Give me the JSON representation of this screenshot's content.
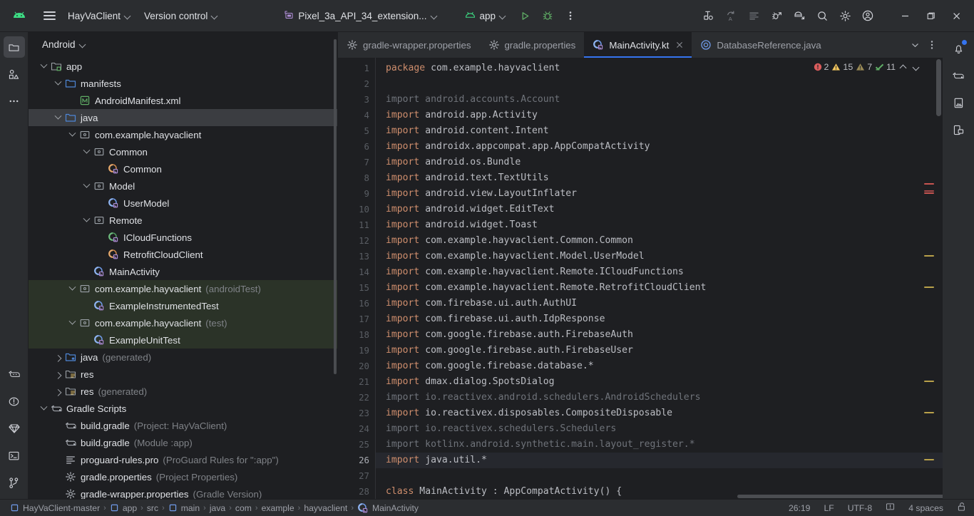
{
  "toolbar": {
    "logo_icon": "android-logo-icon",
    "menu_icon": "hamburger-menu-icon",
    "project_name": "HayVaClient",
    "vcs_label": "Version control",
    "device_label": "Pixel_3a_API_34_extension...",
    "run_config_label": "app",
    "run_icon": "run-play-icon",
    "debug_icon": "debug-bug-icon",
    "more_icon": "more-vertical-icon",
    "right_icons": [
      "make-project-icon",
      "code-with-me-icon",
      "profiler-icon",
      "app-inspection-icon",
      "device-manager-icon",
      "search-everywhere-icon",
      "settings-gear-icon",
      "account-avatar-icon"
    ],
    "window_minimize": "minimize-icon",
    "window_maximize": "maximize-icon",
    "window_close": "close-icon"
  },
  "left_strip": {
    "top_icons": [
      "project-folder-icon",
      "resource-manager-icon",
      "more-tool-windows-icon"
    ],
    "bottom_icons": [
      "gitlab-icon",
      "problems-icon",
      "gemini-icon",
      "terminal-icon",
      "version-control-icon"
    ]
  },
  "right_strip": {
    "icons": [
      "notifications-bell-icon",
      "gradle-elephant-icon",
      "device-file-explorer-icon",
      "emulator-icon"
    ],
    "notification_dot_color": "#3574f0"
  },
  "project_panel": {
    "view_label": "Android",
    "tree": [
      {
        "indent": 0,
        "arrow": "down",
        "icon": "module-folder-icon",
        "label": "app",
        "sub": "",
        "state": ""
      },
      {
        "indent": 1,
        "arrow": "down",
        "icon": "folder-blue-icon",
        "label": "manifests",
        "sub": "",
        "state": ""
      },
      {
        "indent": 2,
        "arrow": "none",
        "icon": "manifest-xml-icon",
        "label": "AndroidManifest.xml",
        "sub": "",
        "state": ""
      },
      {
        "indent": 1,
        "arrow": "down",
        "icon": "folder-blue-icon",
        "label": "java",
        "sub": "",
        "state": "selected"
      },
      {
        "indent": 2,
        "arrow": "down",
        "icon": "package-icon",
        "label": "com.example.hayvaclient",
        "sub": "",
        "state": ""
      },
      {
        "indent": 3,
        "arrow": "down",
        "icon": "package-icon",
        "label": "Common",
        "sub": "",
        "state": ""
      },
      {
        "indent": 4,
        "arrow": "none",
        "icon": "kotlin-class-orange-icon",
        "label": "Common",
        "sub": "",
        "state": ""
      },
      {
        "indent": 3,
        "arrow": "down",
        "icon": "package-icon",
        "label": "Model",
        "sub": "",
        "state": ""
      },
      {
        "indent": 4,
        "arrow": "none",
        "icon": "kotlin-class-blue-icon",
        "label": "UserModel",
        "sub": "",
        "state": ""
      },
      {
        "indent": 3,
        "arrow": "down",
        "icon": "package-icon",
        "label": "Remote",
        "sub": "",
        "state": ""
      },
      {
        "indent": 4,
        "arrow": "none",
        "icon": "kotlin-interface-green-icon",
        "label": "ICloudFunctions",
        "sub": "",
        "state": ""
      },
      {
        "indent": 4,
        "arrow": "none",
        "icon": "kotlin-class-orange-icon",
        "label": "RetrofitCloudClient",
        "sub": "",
        "state": ""
      },
      {
        "indent": 3,
        "arrow": "none",
        "icon": "kotlin-class-blue-icon",
        "label": "MainActivity",
        "sub": "",
        "state": ""
      },
      {
        "indent": 2,
        "arrow": "down",
        "icon": "package-icon",
        "label": "com.example.hayvaclient",
        "sub": "(androidTest)",
        "state": "test"
      },
      {
        "indent": 3,
        "arrow": "none",
        "icon": "kotlin-class-blue-icon",
        "label": "ExampleInstrumentedTest",
        "sub": "",
        "state": "test"
      },
      {
        "indent": 2,
        "arrow": "down",
        "icon": "package-icon",
        "label": "com.example.hayvaclient",
        "sub": "(test)",
        "state": "test"
      },
      {
        "indent": 3,
        "arrow": "none",
        "icon": "kotlin-class-blue-icon",
        "label": "ExampleUnitTest",
        "sub": "",
        "state": "test"
      },
      {
        "indent": 1,
        "arrow": "right",
        "icon": "folder-generated-icon",
        "label": "java",
        "sub": "(generated)",
        "state": ""
      },
      {
        "indent": 1,
        "arrow": "right",
        "icon": "res-folder-icon",
        "label": "res",
        "sub": "",
        "state": ""
      },
      {
        "indent": 1,
        "arrow": "right",
        "icon": "res-folder-icon",
        "label": "res",
        "sub": "(generated)",
        "state": ""
      },
      {
        "indent": 0,
        "arrow": "down",
        "icon": "gradle-elephant-icon",
        "label": "Gradle Scripts",
        "sub": "",
        "state": ""
      },
      {
        "indent": 1,
        "arrow": "none",
        "icon": "gradle-elephant-icon",
        "label": "build.gradle",
        "sub": "(Project: HayVaClient)",
        "state": ""
      },
      {
        "indent": 1,
        "arrow": "none",
        "icon": "gradle-elephant-icon",
        "label": "build.gradle",
        "sub": "(Module :app)",
        "state": ""
      },
      {
        "indent": 1,
        "arrow": "none",
        "icon": "text-file-icon",
        "label": "proguard-rules.pro",
        "sub": "(ProGuard Rules for \":app\")",
        "state": ""
      },
      {
        "indent": 1,
        "arrow": "none",
        "icon": "properties-gear-icon",
        "label": "gradle.properties",
        "sub": "(Project Properties)",
        "state": ""
      },
      {
        "indent": 1,
        "arrow": "none",
        "icon": "properties-gear-icon",
        "label": "gradle-wrapper.properties",
        "sub": "(Gradle Version)",
        "state": ""
      }
    ]
  },
  "editor": {
    "tabs": [
      {
        "icon": "properties-gear-icon",
        "label": "gradle-wrapper.properties",
        "active": false,
        "closable": false
      },
      {
        "icon": "properties-gear-icon",
        "label": "gradle.properties",
        "active": false,
        "closable": false
      },
      {
        "icon": "kotlin-class-blue-icon",
        "label": "MainActivity.kt",
        "active": true,
        "closable": true
      },
      {
        "icon": "java-class-icon",
        "label": "DatabaseReference.java",
        "active": false,
        "closable": false
      }
    ],
    "tab_overflow_icon": "chevron-down-icon",
    "tab_options_icon": "more-vertical-icon",
    "inspections": {
      "error_icon": "error-circle-icon",
      "error_count": "2",
      "error_color": "#db5c5c",
      "warning_icon": "warning-triangle-icon",
      "warning_count": "15",
      "warning_color": "#f2c55c",
      "weak_warning_icon": "weak-warning-triangle-icon",
      "weak_warning_count": "7",
      "weak_warning_color": "#9a8a55",
      "typo_icon": "typo-check-icon",
      "typo_count": "11",
      "typo_color": "#5fad65",
      "prev_icon": "chevron-up-icon",
      "next_icon": "chevron-down-icon"
    },
    "lines": [
      {
        "n": 1,
        "tokens": [
          {
            "t": "package",
            "c": "kw"
          },
          {
            "t": " com.example.hayvaclient",
            "c": "plain"
          }
        ],
        "current": false,
        "mark": ""
      },
      {
        "n": 2,
        "tokens": [],
        "current": false,
        "mark": ""
      },
      {
        "n": 3,
        "tokens": [
          {
            "t": "import android.accounts.Account",
            "c": "dim"
          }
        ],
        "current": false,
        "mark": ""
      },
      {
        "n": 4,
        "tokens": [
          {
            "t": "import",
            "c": "kw"
          },
          {
            "t": " android.app.Activity",
            "c": "plain"
          }
        ],
        "current": false,
        "mark": ""
      },
      {
        "n": 5,
        "tokens": [
          {
            "t": "import",
            "c": "kw"
          },
          {
            "t": " android.content.Intent",
            "c": "plain"
          }
        ],
        "current": false,
        "mark": ""
      },
      {
        "n": 6,
        "tokens": [
          {
            "t": "import",
            "c": "kw"
          },
          {
            "t": " androidx.appcompat.app.AppCompatActivity",
            "c": "plain"
          }
        ],
        "current": false,
        "mark": ""
      },
      {
        "n": 7,
        "tokens": [
          {
            "t": "import",
            "c": "kw"
          },
          {
            "t": " android.os.Bundle",
            "c": "plain"
          }
        ],
        "current": false,
        "mark": ""
      },
      {
        "n": 8,
        "tokens": [
          {
            "t": "import",
            "c": "kw"
          },
          {
            "t": " android.text.TextUtils",
            "c": "plain"
          }
        ],
        "current": false,
        "mark": ""
      },
      {
        "n": 9,
        "tokens": [
          {
            "t": "import",
            "c": "kw"
          },
          {
            "t": " android.view.LayoutInflater",
            "c": "plain"
          }
        ],
        "current": false,
        "mark": "error"
      },
      {
        "n": 10,
        "tokens": [
          {
            "t": "import",
            "c": "kw"
          },
          {
            "t": " android.widget.EditText",
            "c": "plain"
          }
        ],
        "current": false,
        "mark": ""
      },
      {
        "n": 11,
        "tokens": [
          {
            "t": "import",
            "c": "kw"
          },
          {
            "t": " android.widget.Toast",
            "c": "plain"
          }
        ],
        "current": false,
        "mark": ""
      },
      {
        "n": 12,
        "tokens": [
          {
            "t": "import",
            "c": "kw"
          },
          {
            "t": " com.example.hayvaclient.Common.Common",
            "c": "plain"
          }
        ],
        "current": false,
        "mark": ""
      },
      {
        "n": 13,
        "tokens": [
          {
            "t": "import",
            "c": "kw"
          },
          {
            "t": " com.example.hayvaclient.Model.UserModel",
            "c": "plain"
          }
        ],
        "current": false,
        "mark": "warn"
      },
      {
        "n": 14,
        "tokens": [
          {
            "t": "import",
            "c": "kw"
          },
          {
            "t": " com.example.hayvaclient.Remote.ICloudFunctions",
            "c": "plain"
          }
        ],
        "current": false,
        "mark": ""
      },
      {
        "n": 15,
        "tokens": [
          {
            "t": "import",
            "c": "kw"
          },
          {
            "t": " com.example.hayvaclient.Remote.RetrofitCloudClient",
            "c": "plain"
          }
        ],
        "current": false,
        "mark": "warn"
      },
      {
        "n": 16,
        "tokens": [
          {
            "t": "import",
            "c": "kw"
          },
          {
            "t": " com.firebase.ui.auth.AuthUI",
            "c": "plain"
          }
        ],
        "current": false,
        "mark": ""
      },
      {
        "n": 17,
        "tokens": [
          {
            "t": "import",
            "c": "kw"
          },
          {
            "t": " com.firebase.ui.auth.IdpResponse",
            "c": "plain"
          }
        ],
        "current": false,
        "mark": ""
      },
      {
        "n": 18,
        "tokens": [
          {
            "t": "import",
            "c": "kw"
          },
          {
            "t": " com.google.firebase.auth.FirebaseAuth",
            "c": "plain"
          }
        ],
        "current": false,
        "mark": ""
      },
      {
        "n": 19,
        "tokens": [
          {
            "t": "import",
            "c": "kw"
          },
          {
            "t": " com.google.firebase.auth.FirebaseUser",
            "c": "plain"
          }
        ],
        "current": false,
        "mark": ""
      },
      {
        "n": 20,
        "tokens": [
          {
            "t": "import",
            "c": "kw"
          },
          {
            "t": " com.google.firebase.database.*",
            "c": "plain"
          }
        ],
        "current": false,
        "mark": ""
      },
      {
        "n": 21,
        "tokens": [
          {
            "t": "import",
            "c": "kw"
          },
          {
            "t": " dmax.dialog.SpotsDialog",
            "c": "plain"
          }
        ],
        "current": false,
        "mark": "warn"
      },
      {
        "n": 22,
        "tokens": [
          {
            "t": "import io.reactivex.android.schedulers.AndroidSchedulers",
            "c": "dim"
          }
        ],
        "current": false,
        "mark": ""
      },
      {
        "n": 23,
        "tokens": [
          {
            "t": "import",
            "c": "kw"
          },
          {
            "t": " io.reactivex.disposables.CompositeDisposable",
            "c": "plain"
          }
        ],
        "current": false,
        "mark": "warn"
      },
      {
        "n": 24,
        "tokens": [
          {
            "t": "import io.reactivex.schedulers.Schedulers",
            "c": "dim"
          }
        ],
        "current": false,
        "mark": ""
      },
      {
        "n": 25,
        "tokens": [
          {
            "t": "import kotlinx.android.synthetic.main.layout_register.*",
            "c": "dim"
          }
        ],
        "current": false,
        "mark": ""
      },
      {
        "n": 26,
        "tokens": [
          {
            "t": "import",
            "c": "kw"
          },
          {
            "t": " java.util.*",
            "c": "plain"
          }
        ],
        "current": true,
        "mark": "warn"
      },
      {
        "n": 27,
        "tokens": [],
        "current": false,
        "mark": ""
      },
      {
        "n": 28,
        "tokens": [
          {
            "t": "class",
            "c": "kw"
          },
          {
            "t": " MainActivity : AppCompatActivity() {",
            "c": "plain"
          }
        ],
        "current": false,
        "mark": "",
        "run_gutter": "code-preview-icon"
      }
    ]
  },
  "statusbar": {
    "breadcrumbs": [
      {
        "label": "HayVaClient-master",
        "icon": "module-square-icon"
      },
      {
        "label": "app",
        "icon": "module-square-icon"
      },
      {
        "label": "src",
        "icon": ""
      },
      {
        "label": "main",
        "icon": "module-square-icon"
      },
      {
        "label": "java",
        "icon": ""
      },
      {
        "label": "com",
        "icon": ""
      },
      {
        "label": "example",
        "icon": ""
      },
      {
        "label": "hayvaclient",
        "icon": ""
      },
      {
        "label": "MainActivity",
        "icon": "kotlin-class-blue-icon"
      }
    ],
    "separator": "›",
    "caret_position": "26:19",
    "line_separator": "LF",
    "encoding": "UTF-8",
    "events_icon": "event-log-icon",
    "indent": "4 spaces",
    "lock_icon": "unlocked-padlock-icon"
  }
}
